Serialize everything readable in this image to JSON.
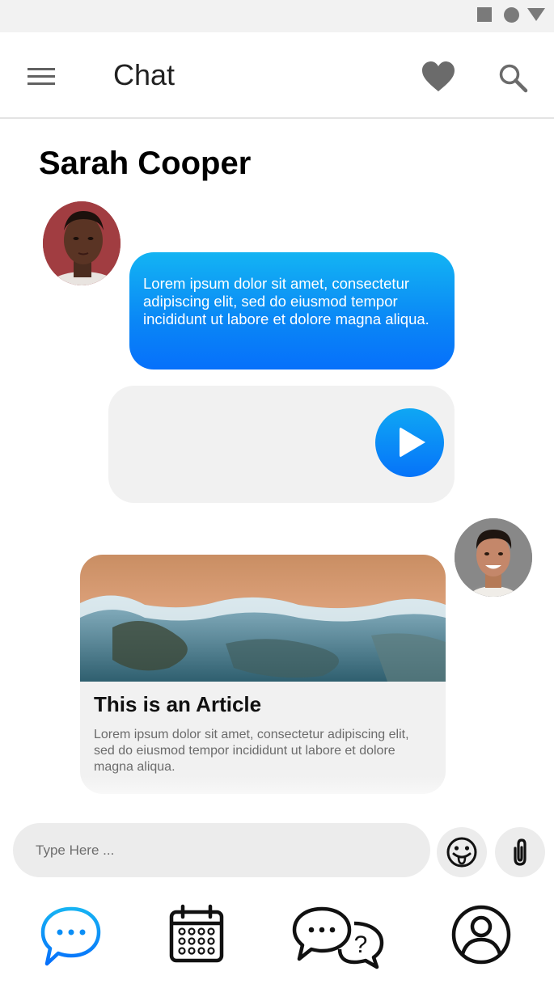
{
  "app_bar": {
    "title": "Chat",
    "icons": [
      "menu-icon",
      "heart-icon",
      "search-icon"
    ]
  },
  "conversation": {
    "contact_name": "Sarah Cooper",
    "messages": {
      "text_message": "Lorem ipsum dolor sit amet, consectetur adipiscing elit, sed do eiusmod tempor incididunt ut labore et dolore magna aliqua.",
      "article": {
        "title": "This is an Article",
        "description": "Lorem ipsum dolor sit amet, consectetur adipiscing elit, sed do eiusmod tempor incididunt ut labore et dolore magna aliqua."
      }
    }
  },
  "composer": {
    "placeholder": "Type Here ...",
    "value": ""
  },
  "bottom_nav": {
    "items": [
      "chat-icon",
      "calendar-icon",
      "faq-chat-icon",
      "profile-icon"
    ],
    "active": "chat-icon"
  },
  "colors": {
    "accent": "#0a86f6",
    "accent_light": "#13b4f3",
    "bubble_gray": "#f1f1f1",
    "icon_gray": "#616161"
  }
}
